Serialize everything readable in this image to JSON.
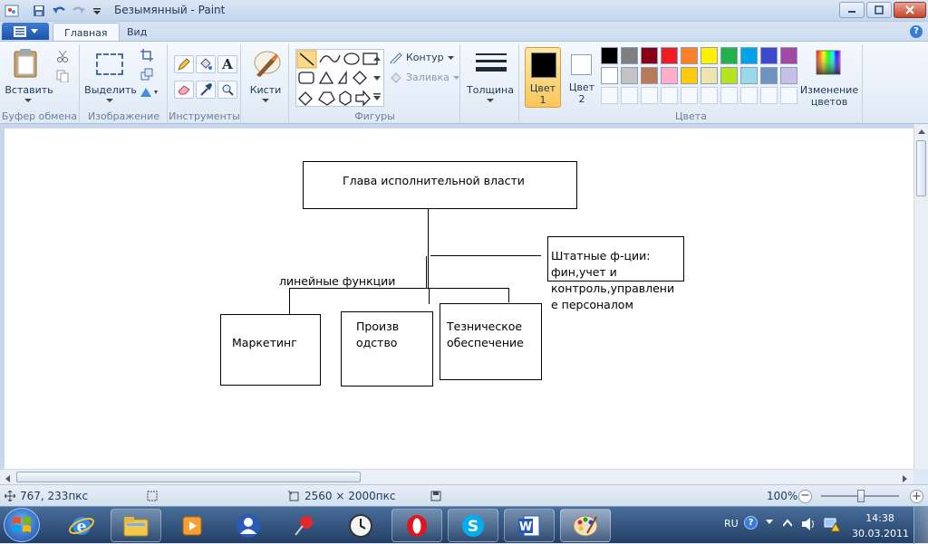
{
  "window": {
    "title": "Безымянный - Paint"
  },
  "tabs": {
    "home": "Главная",
    "view": "Вид"
  },
  "ribbon": {
    "paste": "Вставить",
    "clipboard_group": "Буфер обмена",
    "select": "Выделить",
    "image_group": "Изображение",
    "tools_group": "Инструменты",
    "brushes": "Кисти",
    "outline": "Контур",
    "fill": "Заливка",
    "shapes_group": "Фигуры",
    "size": "Толщина",
    "color1": "Цвет\n1",
    "color2": "Цвет\n2",
    "edit_colors": "Изменение\nцветов",
    "colors_group": "Цвета"
  },
  "palette": [
    "#000000",
    "#7f7f7f",
    "#880015",
    "#ed1c24",
    "#ff7f27",
    "#fff200",
    "#22b14c",
    "#00a2e8",
    "#3f48cc",
    "#a349a4",
    "#ffffff",
    "#c3c3c3",
    "#b97a57",
    "#ffaec9",
    "#ffc90e",
    "#efe4b0",
    "#b5e61d",
    "#99d9ea",
    "#7092be",
    "#c8bfe7"
  ],
  "colors": {
    "color1": "#000000",
    "color2": "#ffffff"
  },
  "diagram": {
    "head": "Глава исполнительной власти",
    "staff": "Штатные ф-ции:\nфин,учет и\nконтроль,управлени\nе персоналом",
    "linear": "линейные функции",
    "marketing": "Маркетинг",
    "production": "Произв\nодство",
    "technical": "Тезническое\nобеспечение"
  },
  "status": {
    "cursor": "767, 233пкс",
    "size": "2560 × 2000пкс",
    "zoom": "100%"
  },
  "taskbar": {
    "lang": "RU",
    "time": "14:38",
    "date": "30.03.2011"
  }
}
